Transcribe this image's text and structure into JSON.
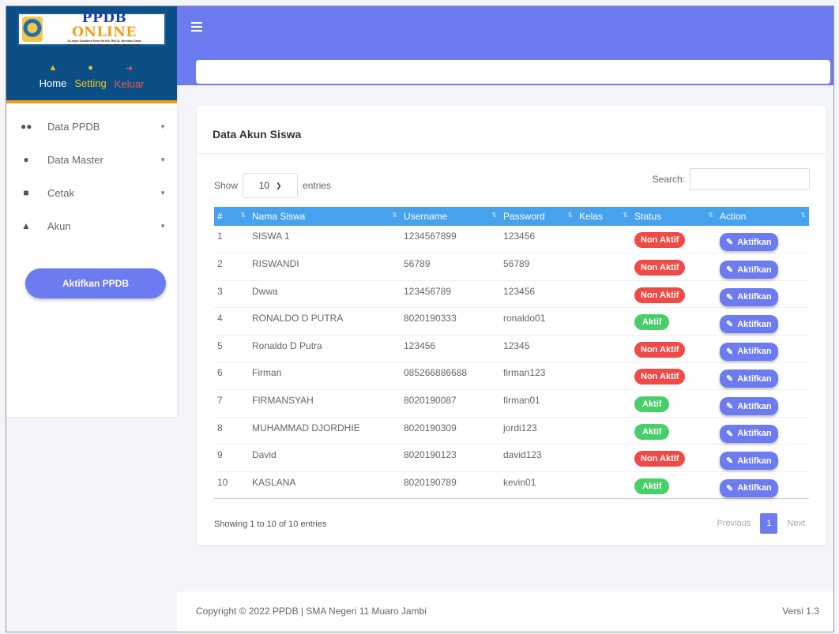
{
  "brand": {
    "title_a": "PPDB ",
    "title_b": "ONLINE",
    "address_1": "Jl.Lintas Sumatera Desa No.KM. RW.14, Mendalo Darat,",
    "address_2": "Kec.Jambi Luar Kota, Kabupaten Muaro Jambi, Jambi"
  },
  "topnav": [
    {
      "label": "Home",
      "icon": "home-icon"
    },
    {
      "label": "Setting",
      "icon": "user-setting-icon"
    },
    {
      "label": "Keluar",
      "icon": "sign-out-icon"
    }
  ],
  "sidebar": {
    "items": [
      {
        "label": "Data PPDB",
        "icon": "users-icon"
      },
      {
        "label": "Data Master",
        "icon": "drop-icon"
      },
      {
        "label": "Cetak",
        "icon": "book-icon"
      },
      {
        "label": "Akun",
        "icon": "user-icon"
      }
    ],
    "activate_button": "Aktifkan PPDB"
  },
  "card": {
    "title": "Data Akun Siswa",
    "show_label": "Show",
    "entries_value": "10",
    "entries_label": "entries",
    "search_label": "Search:",
    "search_value": ""
  },
  "table": {
    "headers": [
      "#",
      "Nama Siswa",
      "Username",
      "Password",
      "Kelas",
      "Status",
      "Action"
    ],
    "rows": [
      {
        "no": "1",
        "nama": "SISWA 1",
        "username": "1234567899",
        "password": "123456",
        "kelas": "",
        "status": "Non Aktif",
        "action": "Aktifkan"
      },
      {
        "no": "2",
        "nama": "RISWANDI",
        "username": "56789",
        "password": "56789",
        "kelas": "",
        "status": "Non Aktif",
        "action": "Aktifkan"
      },
      {
        "no": "3",
        "nama": "Dwwa",
        "username": "123456789",
        "password": "123456",
        "kelas": "",
        "status": "Non Aktif",
        "action": "Aktifkan"
      },
      {
        "no": "4",
        "nama": "RONALDO D PUTRA",
        "username": "8020190333",
        "password": "ronaldo01",
        "kelas": "",
        "status": "Aktif",
        "action": "Aktifkan"
      },
      {
        "no": "5",
        "nama": "Ronaldo D Putra",
        "username": "123456",
        "password": "12345",
        "kelas": "",
        "status": "Non Aktif",
        "action": "Aktifkan"
      },
      {
        "no": "6",
        "nama": "Firman",
        "username": "085266886688",
        "password": "firman123",
        "kelas": "",
        "status": "Non Aktif",
        "action": "Aktifkan"
      },
      {
        "no": "7",
        "nama": "FIRMANSYAH",
        "username": "8020190087",
        "password": "firman01",
        "kelas": "",
        "status": "Aktif",
        "action": "Aktifkan"
      },
      {
        "no": "8",
        "nama": "MUHAMMAD DJORDHIE",
        "username": "8020190309",
        "password": "jordi123",
        "kelas": "",
        "status": "Aktif",
        "action": "Aktifkan"
      },
      {
        "no": "9",
        "nama": "David",
        "username": "8020190123",
        "password": "david123",
        "kelas": "",
        "status": "Non Aktif",
        "action": "Aktifkan"
      },
      {
        "no": "10",
        "nama": "KASLANA",
        "username": "8020190789",
        "password": "kevin01",
        "kelas": "",
        "status": "Aktif",
        "action": "Aktifkan"
      }
    ]
  },
  "pagination": {
    "info": "Showing 1 to 10 of 10 entries",
    "previous": "Previous",
    "current": "1",
    "next": "Next"
  },
  "footer": {
    "copyright": "Copyright © 2022 PPDB | SMA Negeri 11 Muaro Jambi",
    "version": "Versi 1.3"
  },
  "colors": {
    "primary": "#6c7bf0",
    "brand_blue": "#0b4f86",
    "header_table": "#46a2ee",
    "status_non": "#ef4a45",
    "status_aktif": "#49cf6a",
    "accent_orange": "#f39a1b"
  }
}
